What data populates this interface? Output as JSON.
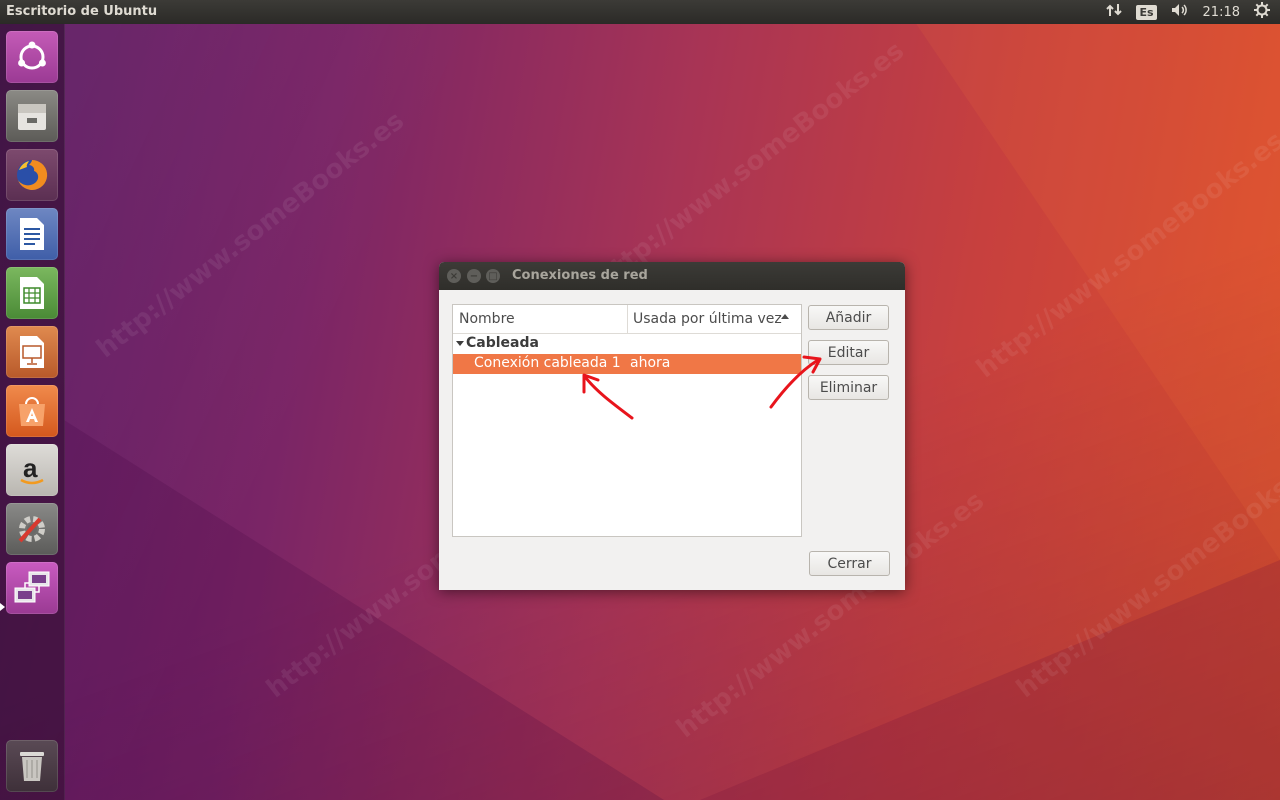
{
  "panel": {
    "title": "Escritorio de Ubuntu",
    "keyboard_layout": "Es",
    "clock": "21:18"
  },
  "launcher": {
    "items": [
      {
        "icon": "ubuntu-dash-icon"
      },
      {
        "icon": "files-icon"
      },
      {
        "icon": "firefox-icon"
      },
      {
        "icon": "libreoffice-writer-icon"
      },
      {
        "icon": "libreoffice-calc-icon"
      },
      {
        "icon": "libreoffice-impress-icon"
      },
      {
        "icon": "software-center-icon"
      },
      {
        "icon": "amazon-icon"
      },
      {
        "icon": "system-settings-icon"
      },
      {
        "icon": "network-connections-icon",
        "active": true
      },
      {
        "icon": "trash-icon"
      }
    ]
  },
  "dialog": {
    "title": "Conexiones de red",
    "columns": [
      "Nombre",
      "Usada por última vez"
    ],
    "group": "Cableada",
    "rows": [
      {
        "name": "Conexión cableada 1",
        "last_used": "ahora",
        "selected": true
      }
    ],
    "buttons": {
      "add": "Añadir",
      "edit": "Editar",
      "delete": "Eliminar",
      "close": "Cerrar"
    }
  },
  "watermark": "http://www.someBooks.es",
  "colors": {
    "selection": "#f07746",
    "panel": "#3c3b37",
    "annotation": "#e8141c"
  }
}
